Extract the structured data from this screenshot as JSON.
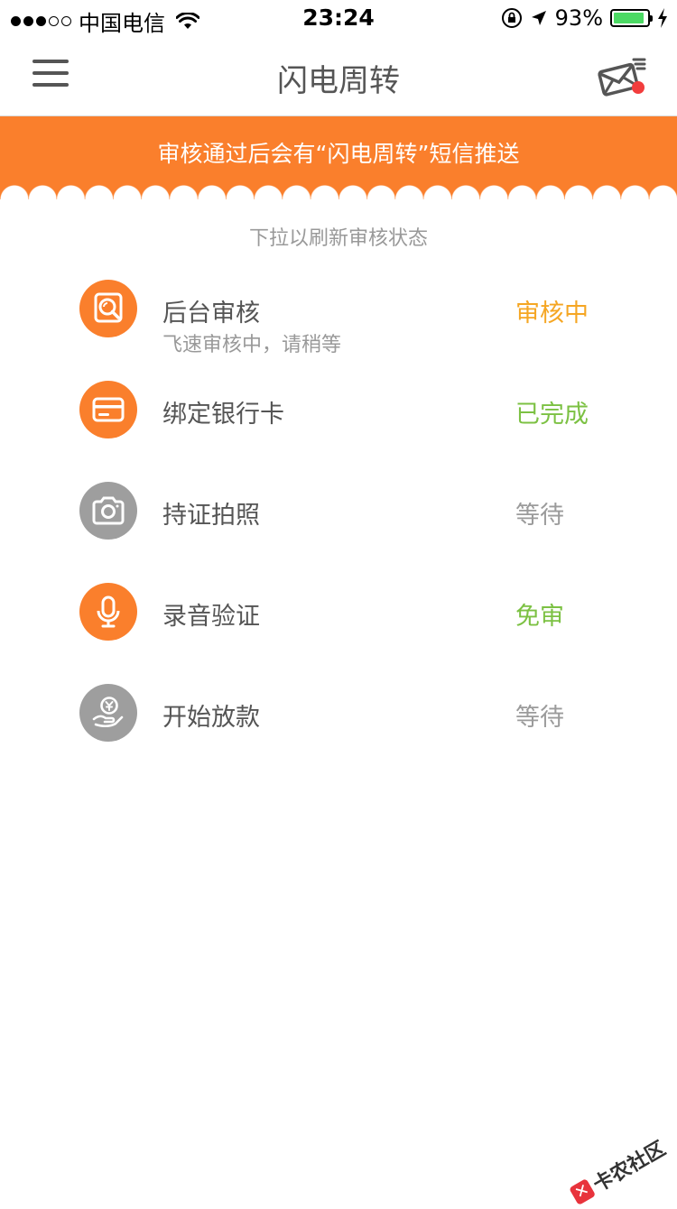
{
  "status_bar": {
    "carrier": "中国电信",
    "time": "23:24",
    "battery": "93%",
    "battery_level": 0.93
  },
  "nav": {
    "title": "闪电周转"
  },
  "banner": {
    "text": "审核通过后会有“闪电周转”短信推送"
  },
  "refresh_hint": "下拉以刷新审核状态",
  "steps": [
    {
      "title": "后台审核",
      "subtitle": "飞速审核中，请稍等",
      "status": "审核中",
      "icon": "review-search-icon"
    },
    {
      "title": "绑定银行卡",
      "status": "已完成",
      "icon": "bank-card-icon"
    },
    {
      "title": "持证拍照",
      "status": "等待",
      "icon": "camera-icon"
    },
    {
      "title": "录音验证",
      "status": "免审",
      "icon": "microphone-icon"
    },
    {
      "title": "开始放款",
      "status": "等待",
      "icon": "loan-yuan-icon"
    }
  ],
  "colors": {
    "accent": "#fa7f2c",
    "status_reviewing": "#f5a623",
    "status_done": "#7cc143",
    "status_waiting": "#9b9b9b",
    "icon_inactive": "#9e9e9e"
  },
  "watermark": "卡农社区"
}
